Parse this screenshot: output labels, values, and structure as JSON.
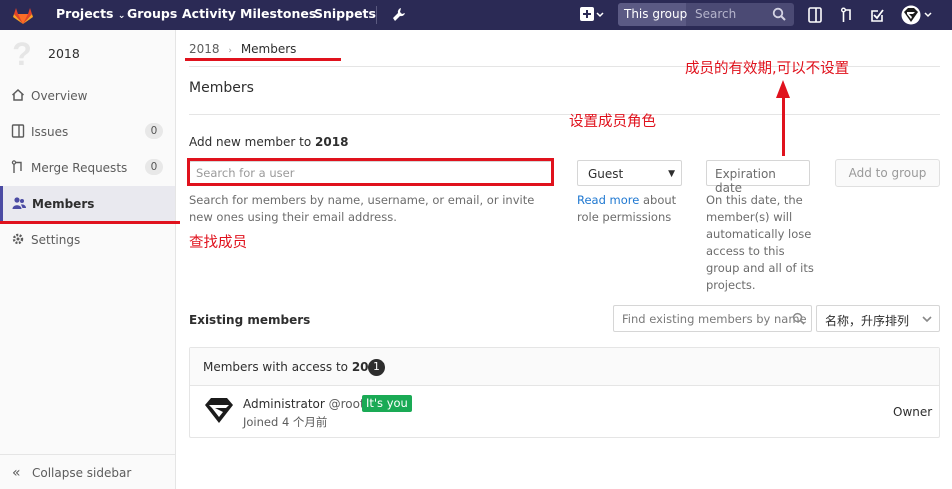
{
  "topnav": {
    "projects": "Projects",
    "groups": "Groups",
    "activity": "Activity",
    "milestones": "Milestones",
    "snippets": "Snippets",
    "scope": "This group",
    "search_placeholder": "Search"
  },
  "sidebar": {
    "group_name": "2018",
    "items": [
      {
        "label": "Overview",
        "icon": "home-icon"
      },
      {
        "label": "Issues",
        "icon": "issues-icon",
        "count": "0"
      },
      {
        "label": "Merge Requests",
        "icon": "merge-request-icon",
        "count": "0"
      },
      {
        "label": "Members",
        "icon": "users-icon"
      },
      {
        "label": "Settings",
        "icon": "gear-icon"
      }
    ],
    "collapse": "Collapse sidebar"
  },
  "breadcrumb": {
    "parent": "2018",
    "current": "Members"
  },
  "page_title": "Members",
  "add_member": {
    "label_prefix": "Add new member to ",
    "group": "2018",
    "search_placeholder": "Search for a user",
    "help": "Search for members by name, username, or email, or invite new ones using their email address.",
    "role_value": "Guest",
    "role_help_link": "Read more",
    "role_help_rest": " about role permissions",
    "expiration_placeholder": "Expiration date",
    "expiration_help": "On this date, the member(s) will automatically lose access to this group and all of its projects.",
    "add_button": "Add to group"
  },
  "existing": {
    "label": "Existing members",
    "filter_placeholder": "Find existing members by name",
    "sort_label": "名称，升序排列"
  },
  "members_panel": {
    "header_prefix": "Members with access to ",
    "group": "2018",
    "count": "1",
    "member": {
      "name": "Administrator",
      "username": "@root",
      "badge": "It's you",
      "joined": "Joined 4 个月前",
      "role": "Owner"
    }
  },
  "annotations": {
    "expiration_note": "成员的有效期,可以不设置",
    "role_note": "设置成员角色",
    "search_note": "查找成员",
    "color": "#e0121d"
  }
}
